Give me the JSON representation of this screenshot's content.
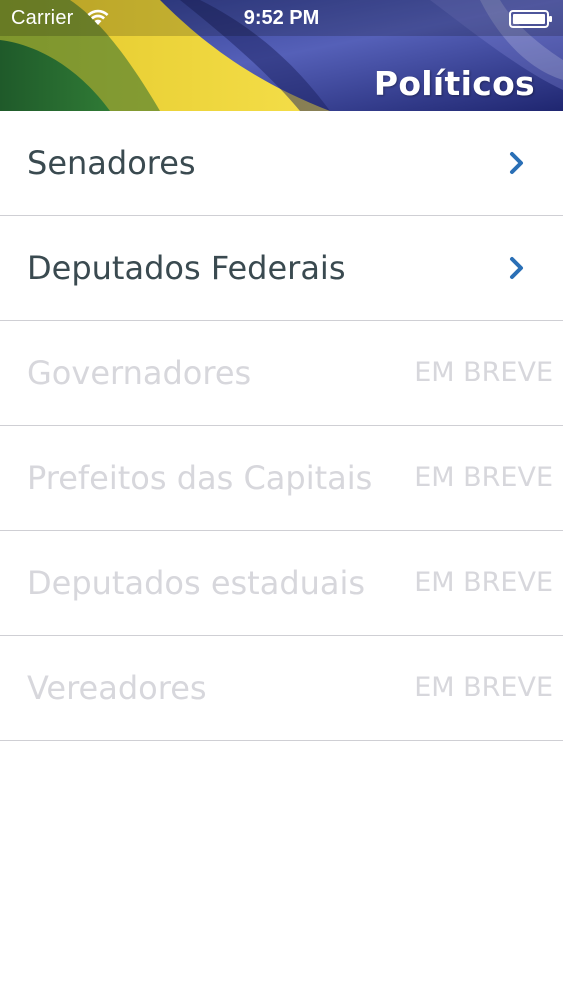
{
  "status_bar": {
    "carrier": "Carrier",
    "time": "9:52 PM",
    "wifi_icon": "wifi-icon",
    "battery_icon": "battery-icon"
  },
  "header": {
    "title": "Políticos"
  },
  "list": {
    "items": [
      {
        "label": "Senadores",
        "enabled": true,
        "accessory_icon": "chevron-right-icon"
      },
      {
        "label": "Deputados Federais",
        "enabled": true,
        "accessory_icon": "chevron-right-icon"
      },
      {
        "label": "Governadores",
        "enabled": false,
        "badge": "EM BREVE"
      },
      {
        "label": "Prefeitos das Capitais",
        "enabled": false,
        "badge": "EM BREVE"
      },
      {
        "label": "Deputados estaduais",
        "enabled": false,
        "badge": "EM BREVE"
      },
      {
        "label": "Vereadores",
        "enabled": false,
        "badge": "EM BREVE"
      }
    ]
  },
  "colors": {
    "accent": "#2a6fb6",
    "enabled_text": "#3a4a50",
    "disabled_text": "#d7d7dc",
    "separator": "#cfcfd4"
  }
}
